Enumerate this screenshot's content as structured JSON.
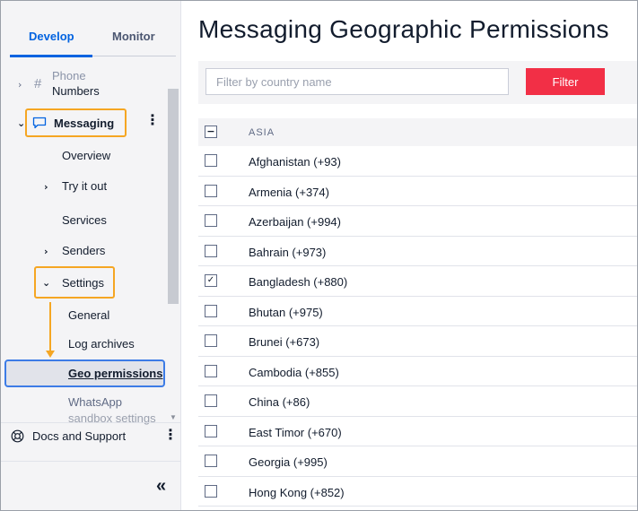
{
  "sidebar": {
    "tabs": {
      "develop": "Develop",
      "monitor": "Monitor"
    },
    "phone_numbers": "Phone Numbers",
    "phone_numbers_l1": "Phone",
    "phone_numbers_l2": "Numbers",
    "messaging": "Messaging",
    "overview": "Overview",
    "try_it_out": "Try it out",
    "services": "Services",
    "senders": "Senders",
    "settings": "Settings",
    "general": "General",
    "log_archives": "Log archives",
    "geo_permissions": "Geo permissions",
    "whatsapp_l1": "WhatsApp",
    "whatsapp_l2": "sandbox settings",
    "docs_support": "Docs and Support",
    "collapse": "«"
  },
  "main": {
    "title": "Messaging Geographic Permissions",
    "filter_placeholder": "Filter by country name",
    "filter_button": "Filter",
    "region": "ASIA",
    "countries": [
      {
        "label": "Afghanistan  (+93)",
        "checked": false
      },
      {
        "label": "Armenia  (+374)",
        "checked": false
      },
      {
        "label": "Azerbaijan  (+994)",
        "checked": false
      },
      {
        "label": "Bahrain  (+973)",
        "checked": false
      },
      {
        "label": "Bangladesh  (+880)",
        "checked": true
      },
      {
        "label": "Bhutan  (+975)",
        "checked": false
      },
      {
        "label": "Brunei  (+673)",
        "checked": false
      },
      {
        "label": "Cambodia  (+855)",
        "checked": false
      },
      {
        "label": "China  (+86)",
        "checked": false
      },
      {
        "label": "East Timor  (+670)",
        "checked": false
      },
      {
        "label": "Georgia  (+995)",
        "checked": false
      },
      {
        "label": "Hong Kong  (+852)",
        "checked": false
      }
    ]
  },
  "colors": {
    "accent": "#0263e0",
    "filter_button": "#f22f46",
    "highlight_orange": "#f5a623",
    "highlight_blue": "#3d7ce6"
  },
  "icons": {
    "hash": "hash-icon",
    "chat": "chat-bubble-icon",
    "support": "lifebuoy-icon"
  }
}
